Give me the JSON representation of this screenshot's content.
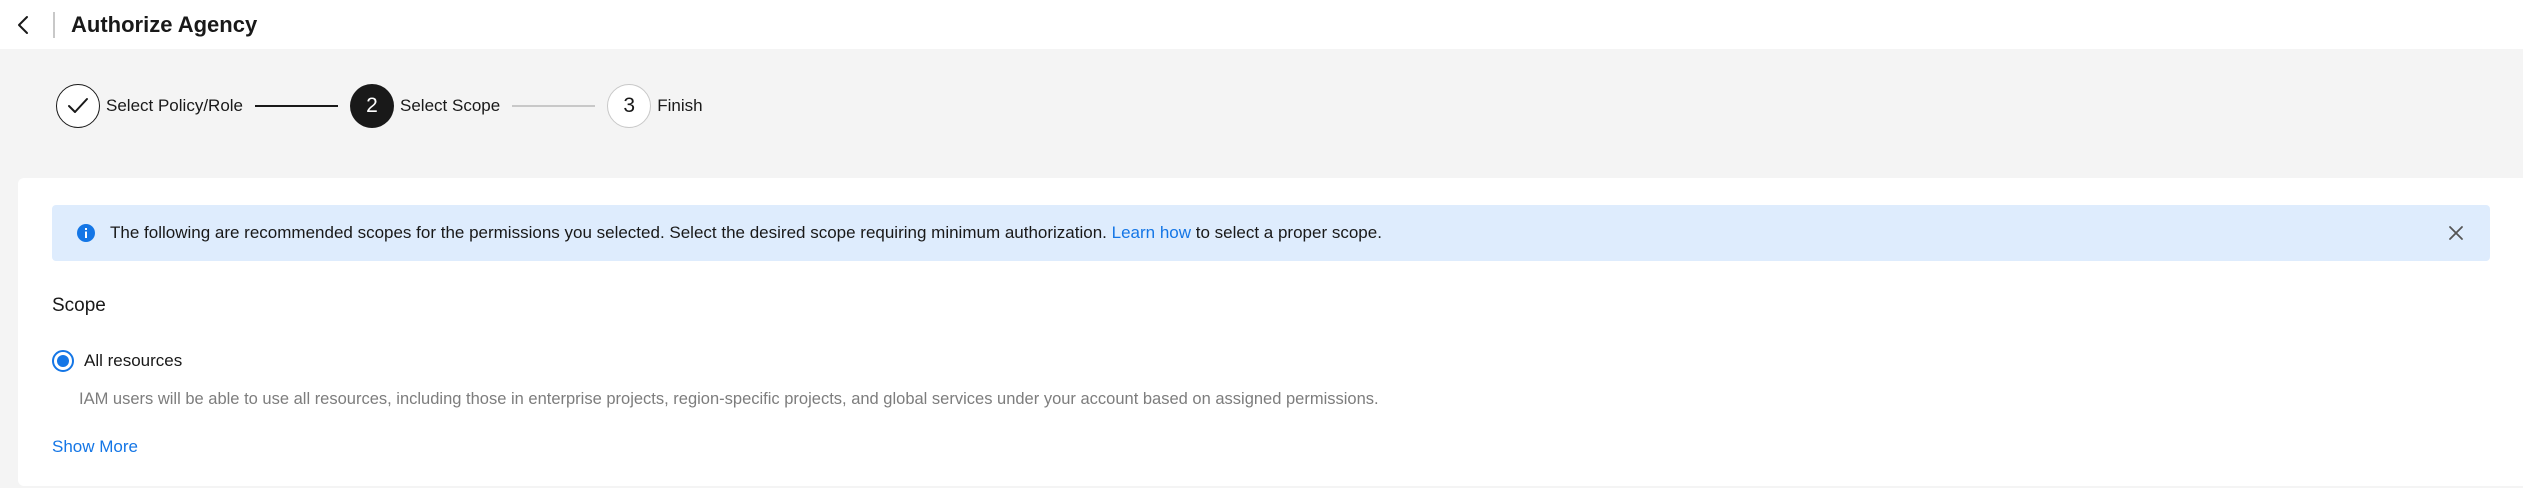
{
  "header": {
    "title": "Authorize Agency"
  },
  "stepper": {
    "steps": [
      {
        "number": "",
        "label": "Select Policy/Role",
        "state": "done"
      },
      {
        "number": "2",
        "label": "Select Scope",
        "state": "active"
      },
      {
        "number": "3",
        "label": "Finish",
        "state": "pending"
      }
    ]
  },
  "alert": {
    "text_before": "The following are recommended scopes for the permissions you selected. Select the desired scope requiring minimum authorization.",
    "link": "Learn how",
    "text_after": "to select a proper scope."
  },
  "scope": {
    "title": "Scope",
    "option_label": "All resources",
    "option_selected": true,
    "option_description": "IAM users will be able to use all resources, including those in enterprise projects, region-specific projects, and global services under your account based on assigned permissions.",
    "show_more": "Show More"
  },
  "colors": {
    "accent": "#1476e6",
    "alert_bg": "#deecfd",
    "active_step": "#191919"
  }
}
